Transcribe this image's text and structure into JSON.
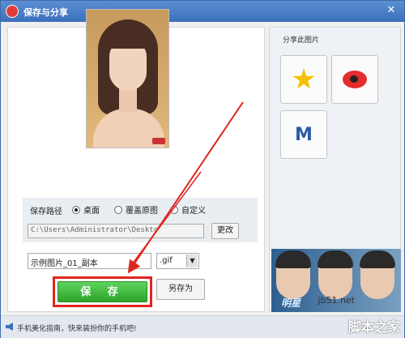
{
  "window": {
    "title": "保存与分享",
    "close_glyph": "✕"
  },
  "save_path": {
    "label": "保存路径",
    "options": [
      {
        "label": "桌面",
        "selected": true
      },
      {
        "label": "覆盖原图",
        "selected": false
      },
      {
        "label": "自定义",
        "selected": false
      }
    ],
    "path_value": "C:\\Users\\Administrator\\Deskto",
    "change_label": "更改"
  },
  "file": {
    "name_value": "示例图片_01_副本",
    "extension": ".gif"
  },
  "buttons": {
    "save_label": "保 存",
    "save_as_label": "另存为"
  },
  "share": {
    "title": "分享此图片",
    "targets": [
      {
        "name": "qzone",
        "icon": "qzone-star-icon"
      },
      {
        "name": "weibo",
        "icon": "weibo-icon"
      },
      {
        "name": "momo",
        "icon": "m-logo-icon"
      }
    ]
  },
  "promo": {
    "text": "明星"
  },
  "status": {
    "text": "手机美化指南，快来装扮你的手机吧!"
  },
  "watermark": {
    "site": "jb51.net",
    "brand": "脚本之家"
  },
  "colors": {
    "accent_red": "#e0251f",
    "save_green": "#2da32b",
    "title_blue": "#3a6fbb"
  }
}
